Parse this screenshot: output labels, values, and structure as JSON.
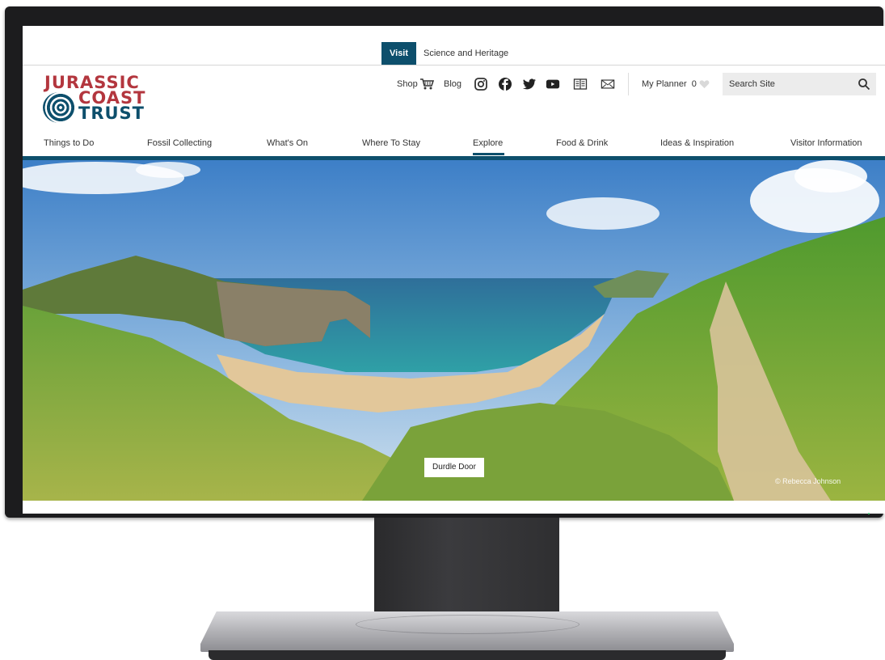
{
  "top_tabs": [
    {
      "label": "Visit",
      "active": true
    },
    {
      "label": "Science and Heritage",
      "active": false
    }
  ],
  "logo": {
    "line1": "JURASSIC",
    "line2": "COAST",
    "line3": "TRUST"
  },
  "header": {
    "shop_label": "Shop",
    "blog_label": "Blog",
    "social_icons": [
      "instagram-icon",
      "facebook-icon",
      "twitter-icon",
      "youtube-icon",
      "book-icon",
      "mail-icon"
    ],
    "planner_label": "My Planner",
    "planner_count": "0",
    "search_placeholder": "Search Site"
  },
  "nav": {
    "items": [
      "Things to Do",
      "Fossil Collecting",
      "What's On",
      "Where To Stay",
      "Explore",
      "Food & Drink",
      "Ideas & Inspiration",
      "Visitor Information"
    ],
    "active": "Explore"
  },
  "hero": {
    "caption": "Durdle Door",
    "credit": "© Rebecca Johnson"
  },
  "colors": {
    "brand_teal": "#0d4f6c",
    "brand_red": "#b3363e"
  }
}
